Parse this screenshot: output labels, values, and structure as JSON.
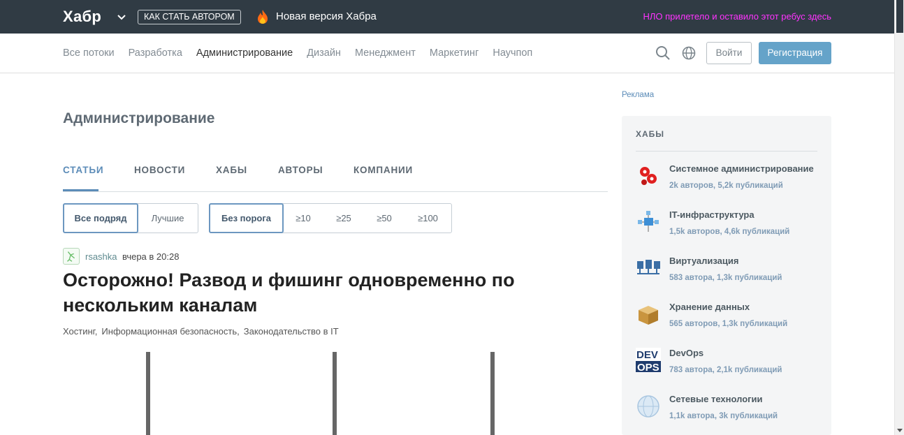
{
  "topbar": {
    "logo": "Хабр",
    "author_button": "Как стать автором",
    "new_version": "Новая версия Хабра",
    "ufo_text": "НЛО прилетело и оставило этот ребус здесь",
    "ufo_color": "#ff33ff"
  },
  "nav": {
    "links": [
      "Все потоки",
      "Разработка",
      "Администрирование",
      "Дизайн",
      "Менеджмент",
      "Маркетинг",
      "Научпоп"
    ],
    "active": "Администрирование",
    "login": "Войти",
    "register": "Регистрация"
  },
  "page": {
    "title": "Администрирование",
    "tabs": [
      "Статьи",
      "Новости",
      "Хабы",
      "Авторы",
      "Компании"
    ],
    "active_tab": "Статьи",
    "sort_filters": [
      "Все подряд",
      "Лучшие"
    ],
    "rating_filters": [
      "Без порога",
      "≥10",
      "≥25",
      "≥50",
      "≥100"
    ]
  },
  "post": {
    "author": "rsashka",
    "time": "вчера в 20:28",
    "title": "Осторожно! Развод и фишинг одновременно по нескольким каналам",
    "hubs": [
      "Хостинг,",
      "Информационная безопасность,",
      "Законодательство в IT"
    ]
  },
  "sidebar": {
    "ad_label": "Реклама",
    "hubs_heading": "Хабы",
    "hubs": [
      {
        "name": "Системное администрирование",
        "stats": "2k авторов, 5,2k публикаций",
        "icon": "gears-icon"
      },
      {
        "name": "IT-инфраструктура",
        "stats": "1,5k авторов, 4,6k публикаций",
        "icon": "network-node-icon"
      },
      {
        "name": "Виртуализация",
        "stats": "583 автора, 1,3k публикаций",
        "icon": "servers-icon"
      },
      {
        "name": "Хранение данных",
        "stats": "565 авторов, 1,3k публикаций",
        "icon": "box-icon"
      },
      {
        "name": "DevOps",
        "stats": "783 автора, 2,1k публикаций",
        "icon": "devops-icon"
      },
      {
        "name": "Сетевые технологии",
        "stats": "1,1k автора, 3k публикаций",
        "icon": "globe-network-icon"
      }
    ]
  }
}
